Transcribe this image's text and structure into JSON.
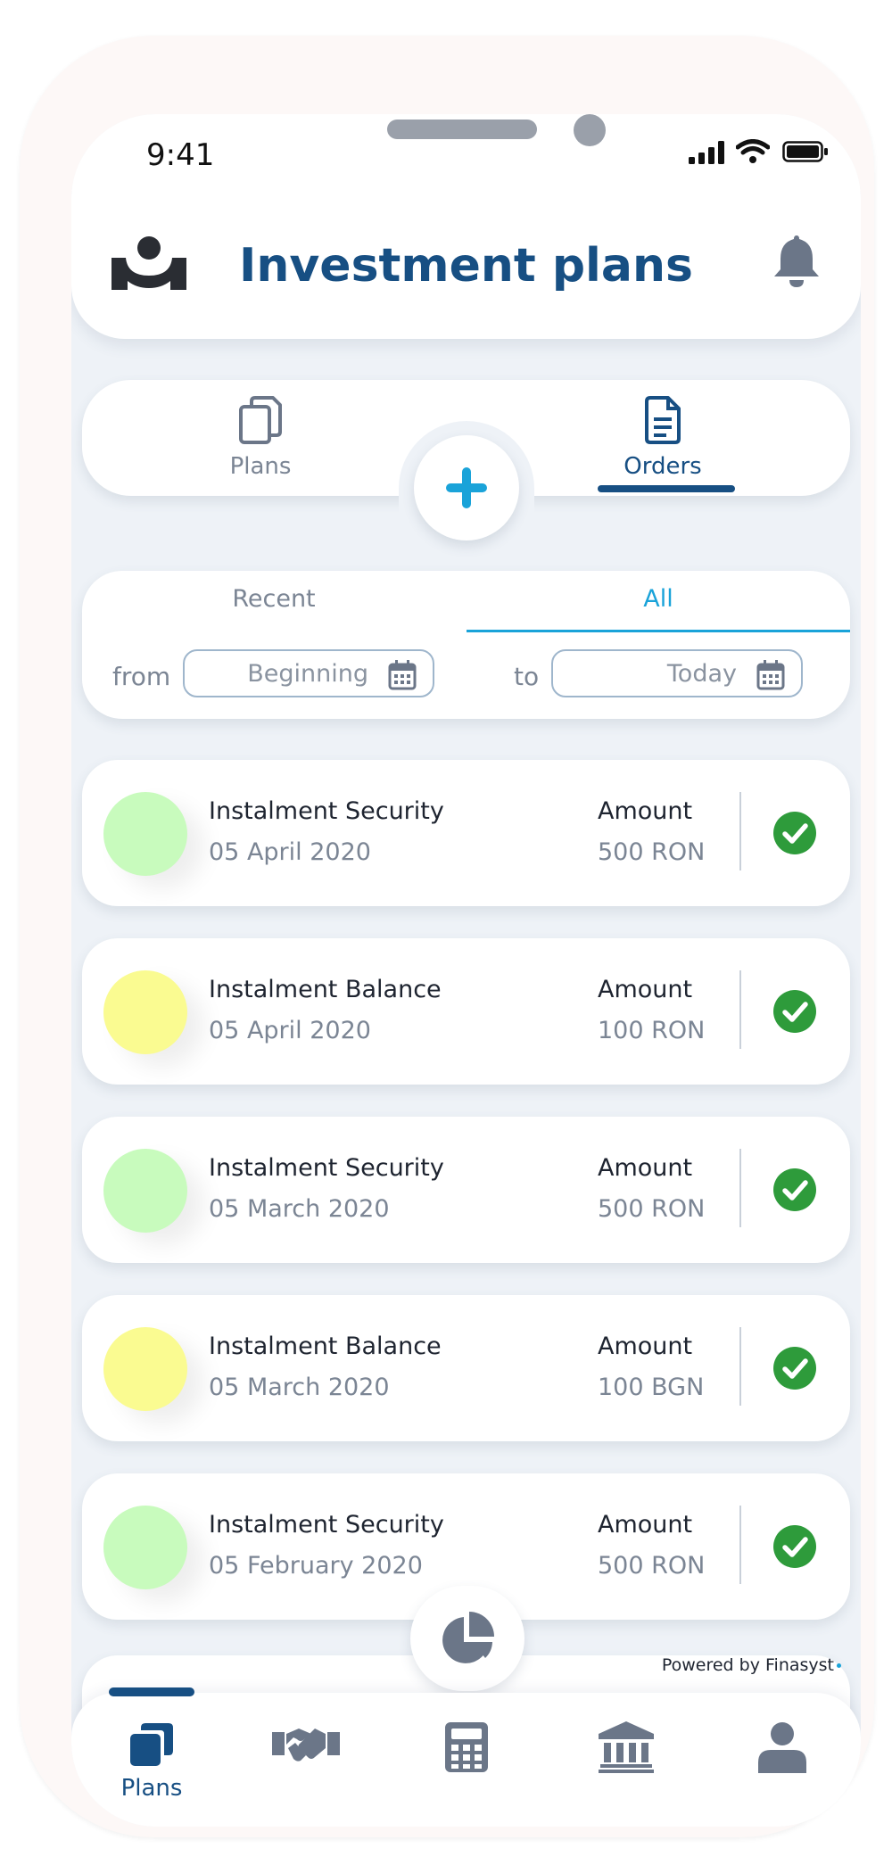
{
  "status_bar": {
    "time": "9:41"
  },
  "header": {
    "title": "Investment plans",
    "logo_icon": "user-logo-icon",
    "bell_icon": "bell-icon"
  },
  "tabs": [
    {
      "label": "Plans",
      "icon": "copy-documents-icon",
      "active": false
    },
    {
      "label": "Orders",
      "icon": "document-icon",
      "active": true
    }
  ],
  "add_button_icon": "plus-icon",
  "filter": {
    "tabs": [
      {
        "label": "Recent",
        "active": false
      },
      {
        "label": "All",
        "active": true
      }
    ],
    "from_label": "from",
    "to_label": "to",
    "from_value": "Beginning",
    "to_value": "Today"
  },
  "orders": [
    {
      "name": "Instalment Security",
      "date": "05 April 2020",
      "amount_label": "Amount",
      "amount": "500 RON",
      "color": "#c8fbbd",
      "status": "completed"
    },
    {
      "name": "Instalment Balance",
      "date": "05 April 2020",
      "amount_label": "Amount",
      "amount": "100 RON",
      "color": "#fafb91",
      "status": "completed"
    },
    {
      "name": "Instalment Security",
      "date": "05 March 2020",
      "amount_label": "Amount",
      "amount": "500 RON",
      "color": "#c8fbbd",
      "status": "completed"
    },
    {
      "name": "Instalment Balance",
      "date": "05 March 2020",
      "amount_label": "Amount",
      "amount": "100 BGN",
      "color": "#fafb91",
      "status": "completed"
    },
    {
      "name": "Instalment Security",
      "date": "05 February 2020",
      "amount_label": "Amount",
      "amount": "500 RON",
      "color": "#c8fbbd",
      "status": "completed"
    }
  ],
  "powered_by": "Powered by Finasyst",
  "bottom_nav": [
    {
      "label": "Plans",
      "icon": "plans-icon",
      "active": true
    },
    {
      "label": "",
      "icon": "handshake-icon",
      "active": false
    },
    {
      "label": "",
      "icon": "calculator-icon",
      "active": false
    },
    {
      "label": "",
      "icon": "bank-icon",
      "active": false
    },
    {
      "label": "",
      "icon": "profile-icon",
      "active": false
    }
  ],
  "colors": {
    "primary": "#174f83",
    "accent": "#1aa3d9",
    "success": "#2e9b3b",
    "icon_gray": "#6b7688"
  }
}
